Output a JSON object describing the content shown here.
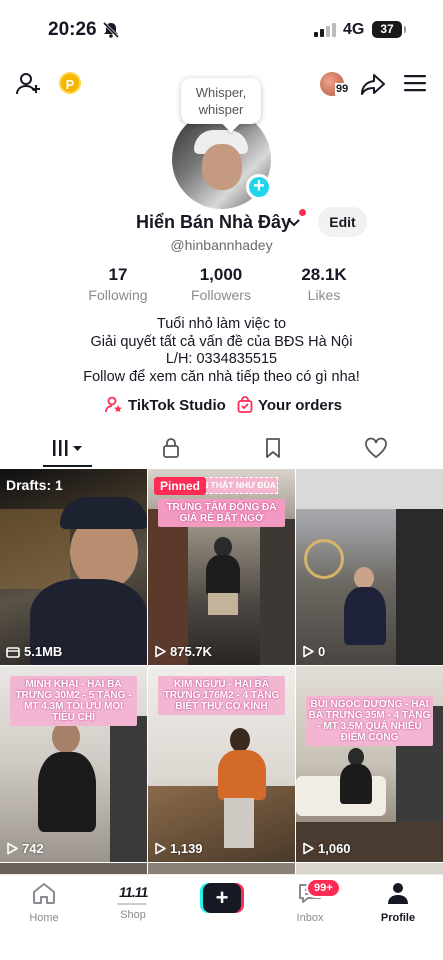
{
  "status_bar": {
    "time": "20:26",
    "network": "4G",
    "battery": "37"
  },
  "header": {
    "coin_label": "P",
    "notification_count": "99"
  },
  "profile": {
    "bubble_text": "Whisper, whisper",
    "name": "Hiển Bán Nhà Đây",
    "edit_label": "Edit",
    "handle": "@hinbannhadey",
    "stats": [
      {
        "value": "17",
        "label": "Following"
      },
      {
        "value": "1,000",
        "label": "Followers"
      },
      {
        "value": "28.1K",
        "label": "Likes"
      }
    ],
    "bio": [
      "Tuổi nhỏ làm việc to",
      "Giải quyết tất cả vấn đề của BĐS Hà Nội",
      "L/H: 0334835515",
      "Follow để xem căn nhà tiếp theo có gì nha!"
    ],
    "links": {
      "studio": "TikTok Studio",
      "orders": "Your orders"
    }
  },
  "tabs": [
    {
      "name": "videos",
      "icon": "grid-bars-icon"
    },
    {
      "name": "private",
      "icon": "lock-icon"
    },
    {
      "name": "saved",
      "icon": "bookmark-icon"
    },
    {
      "name": "liked",
      "icon": "heart-icon"
    }
  ],
  "videos": [
    {
      "label": "Drafts: 1",
      "stat": "5.1MB",
      "stat_icon": "storage-icon",
      "caption": ""
    },
    {
      "label": "Pinned",
      "stat": "875.7K",
      "stat_icon": "play-icon",
      "caption": "TRUNG TÂM ĐỐNG ĐA GIÁ RẺ BẤT NGỜ",
      "caption_top": "N THẬT NHƯ ĐÙA"
    },
    {
      "label": "",
      "stat": "0",
      "stat_icon": "play-icon",
      "caption": ""
    },
    {
      "label": "",
      "stat": "742",
      "stat_icon": "play-icon",
      "caption": "MINH KHAI - HAI BÀ TRƯNG 30M2 - 5 TẦNG - MT 4.3M TỐI ƯU MỌI TIÊU CHÍ"
    },
    {
      "label": "",
      "stat": "1,139",
      "stat_icon": "play-icon",
      "caption": "KIM NGƯU - HAI BÀ TRƯNG 176M2 - 4 TẦNG BIỆT THỰ CÓ KÍNH"
    },
    {
      "label": "",
      "stat": "1,060",
      "stat_icon": "play-icon",
      "caption": "BÙI NGỌC DƯƠNG - HAI BÀ TRƯNG 35M - 4 TẦNG - MT 3.5M QUÁ NHIỀU ĐIỂM CỘNG"
    }
  ],
  "nav": {
    "home": "Home",
    "shop": "Shop",
    "shop_badge": "11.11",
    "create": "+",
    "inbox": "Inbox",
    "inbox_badge": "99+",
    "profile": "Profile"
  },
  "colors": {
    "accent": "#fe2c55",
    "cyan": "#25f4ee",
    "plus": "#20d5ec",
    "text": "#161823",
    "muted": "#8a8b91"
  }
}
